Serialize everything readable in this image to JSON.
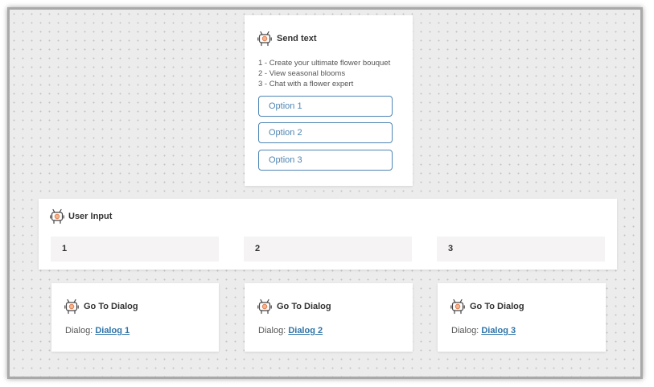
{
  "send_text": {
    "title": "Send text",
    "lines": [
      "1 - Create your ultimate flower bouquet",
      "2 - View seasonal blooms",
      "3 - Chat with a flower expert"
    ],
    "options": [
      "Option 1",
      "Option 2",
      "Option 3"
    ]
  },
  "user_input": {
    "title": "User Input",
    "values": [
      "1",
      "2",
      "3"
    ]
  },
  "go_to_dialogs": [
    {
      "title": "Go To Dialog",
      "label": "Dialog:",
      "link": "Dialog 1"
    },
    {
      "title": "Go To Dialog",
      "label": "Dialog:",
      "link": "Dialog 2"
    },
    {
      "title": "Go To Dialog",
      "label": "Dialog:",
      "link": "Dialog 3"
    }
  ],
  "icons": {
    "node": "robot-icon"
  },
  "colors": {
    "accent": "#4f86b4",
    "link": "#2e74a8",
    "canvas": "#ececec"
  }
}
